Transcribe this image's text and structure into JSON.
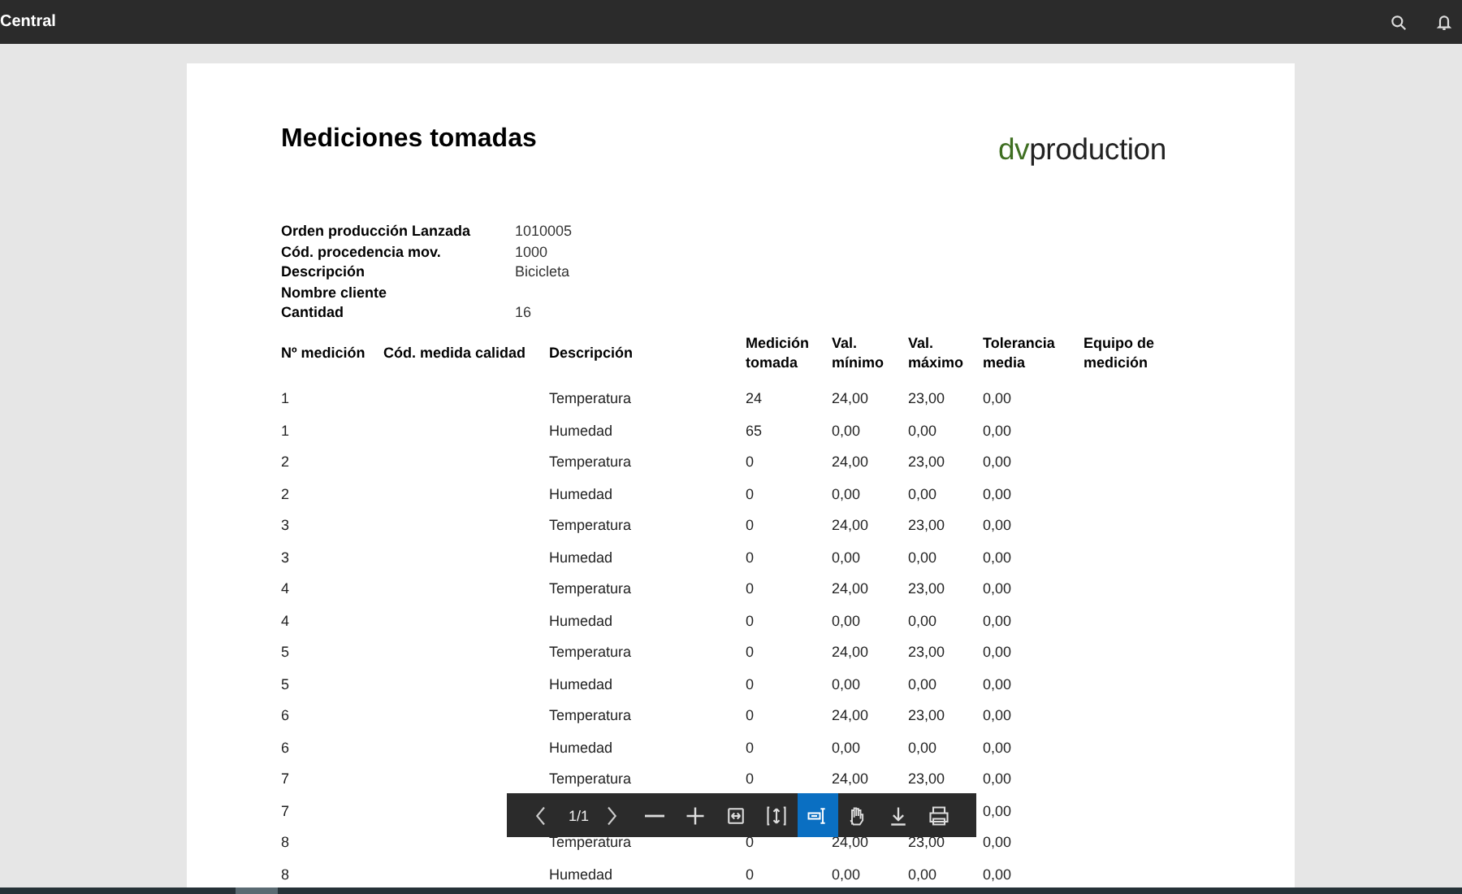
{
  "app_bar": {
    "title": "Central"
  },
  "report": {
    "title": "Mediciones tomadas",
    "logo": {
      "dark_part": "dv",
      "light_part": "production"
    },
    "fields": [
      {
        "label": "Orden producción Lanzada",
        "value": "1010005"
      },
      {
        "label": "Cód. procedencia mov.",
        "value": "1000"
      },
      {
        "label": "Descripción",
        "value": "Bicicleta"
      },
      {
        "label": "Nombre cliente"
      },
      {
        "label": "Cantidad",
        "value": "16"
      }
    ],
    "table": {
      "columns": [
        "Nº medición",
        "Cód. medida calidad",
        "Descripción",
        "Medición tomada",
        "Val. mínimo",
        "Val. máximo",
        "Tolerancia media",
        "Equipo de medición"
      ],
      "rows": [
        [
          "1",
          null,
          "Temperatura",
          "24",
          "24,00",
          "23,00",
          "0,00",
          null
        ],
        [
          "1",
          null,
          "Humedad",
          "65",
          "0,00",
          "0,00",
          "0,00",
          null
        ],
        [
          "2",
          null,
          "Temperatura",
          "0",
          "24,00",
          "23,00",
          "0,00",
          null
        ],
        [
          "2",
          null,
          "Humedad",
          "0",
          "0,00",
          "0,00",
          "0,00",
          null
        ],
        [
          "3",
          null,
          "Temperatura",
          "0",
          "24,00",
          "23,00",
          "0,00",
          null
        ],
        [
          "3",
          null,
          "Humedad",
          "0",
          "0,00",
          "0,00",
          "0,00",
          null
        ],
        [
          "4",
          null,
          "Temperatura",
          "0",
          "24,00",
          "23,00",
          "0,00",
          null
        ],
        [
          "4",
          null,
          "Humedad",
          "0",
          "0,00",
          "0,00",
          "0,00",
          null
        ],
        [
          "5",
          null,
          "Temperatura",
          "0",
          "24,00",
          "23,00",
          "0,00",
          null
        ],
        [
          "5",
          null,
          "Humedad",
          "0",
          "0,00",
          "0,00",
          "0,00",
          null
        ],
        [
          "6",
          null,
          "Temperatura",
          "0",
          "24,00",
          "23,00",
          "0,00",
          null
        ],
        [
          "6",
          null,
          "Humedad",
          "0",
          "0,00",
          "0,00",
          "0,00",
          null
        ],
        [
          "7",
          null,
          "Temperatura",
          "0",
          "24,00",
          "23,00",
          "0,00",
          null
        ],
        [
          "7",
          null,
          null,
          null,
          null,
          null,
          "0,00",
          null
        ],
        [
          "8",
          null,
          "Temperatura",
          "0",
          "24,00",
          "23,00",
          "0,00",
          null
        ],
        [
          "8",
          null,
          "Humedad",
          "0",
          "0,00",
          "0,00",
          "0,00",
          null
        ]
      ]
    }
  },
  "viewer_toolbar": {
    "page": "1/1",
    "tools": [
      {
        "kind": "prev",
        "selected": false
      },
      {
        "kind": "page",
        "selected": false
      },
      {
        "kind": "next",
        "selected": false
      },
      {
        "kind": "zoom-out",
        "selected": false
      },
      {
        "kind": "zoom-in",
        "selected": false
      },
      {
        "kind": "fit-width",
        "selected": false
      },
      {
        "kind": "fit-height",
        "selected": false
      },
      {
        "kind": "select-text",
        "selected": true
      },
      {
        "kind": "pan",
        "selected": false
      },
      {
        "kind": "download",
        "selected": false
      },
      {
        "kind": "print",
        "selected": false
      }
    ]
  }
}
